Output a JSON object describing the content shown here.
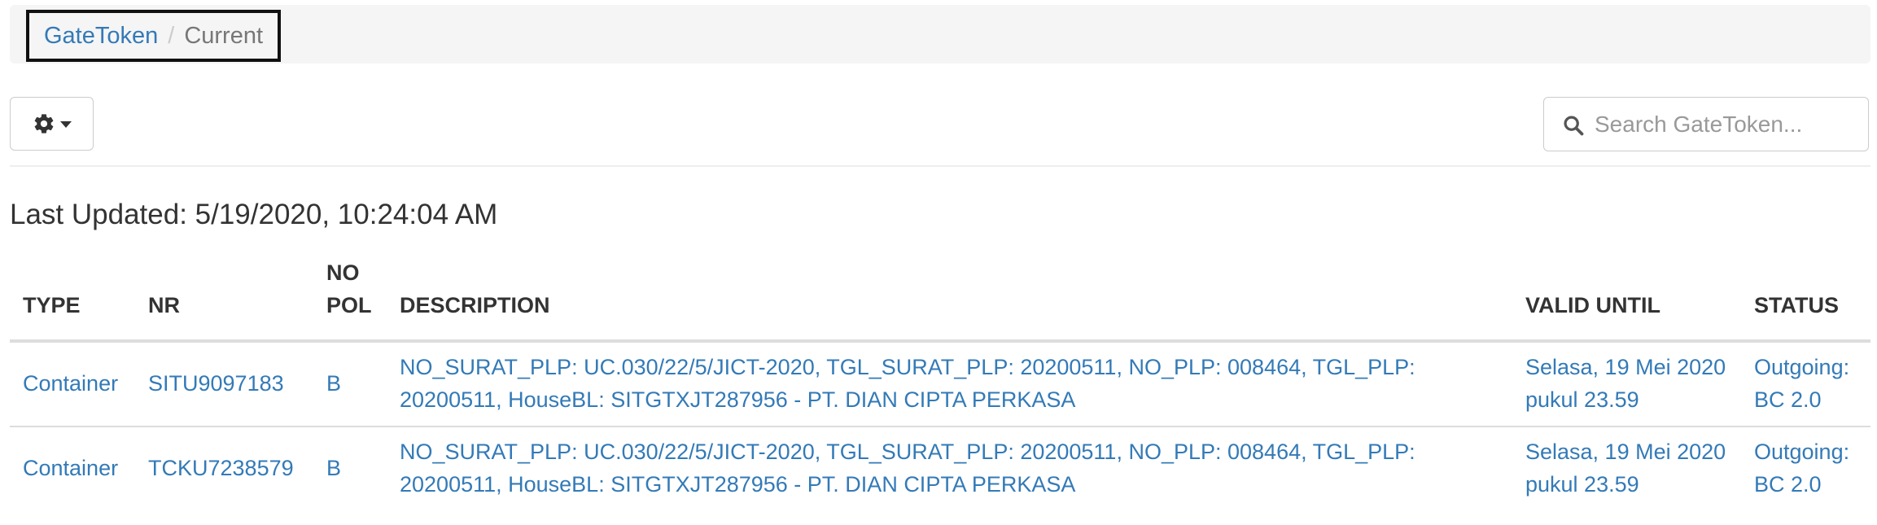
{
  "breadcrumb": {
    "root": "GateToken",
    "separator": "/",
    "current": "Current"
  },
  "toolbar": {
    "settings_icon": "gear-icon",
    "search_placeholder": "Search GateToken...",
    "search_value": ""
  },
  "last_updated": "Last Updated: 5/19/2020, 10:24:04 AM",
  "table": {
    "headers": {
      "type": "TYPE",
      "nr": "NR",
      "no_pol_line1": "NO",
      "no_pol_line2": "POL",
      "description": "DESCRIPTION",
      "valid_until": "VALID UNTIL",
      "status": "STATUS"
    },
    "rows": [
      {
        "type": "Container",
        "nr": "SITU9097183",
        "no_pol": "B",
        "description": "NO_SURAT_PLP: UC.030/22/5/JICT-2020, TGL_SURAT_PLP: 20200511, NO_PLP: 008464, TGL_PLP: 20200511, HouseBL: SITGTXJT287956 - PT. DIAN CIPTA PERKASA",
        "valid_until": "Selasa, 19 Mei 2020 pukul 23.59",
        "status": "Outgoing: BC 2.0"
      },
      {
        "type": "Container",
        "nr": "TCKU7238579",
        "no_pol": "B",
        "description": "NO_SURAT_PLP: UC.030/22/5/JICT-2020, TGL_SURAT_PLP: 20200511, NO_PLP: 008464, TGL_PLP: 20200511, HouseBL: SITGTXJT287956 - PT. DIAN CIPTA PERKASA",
        "valid_until": "Selasa, 19 Mei 2020 pukul 23.59",
        "status": "Outgoing: BC 2.0"
      }
    ]
  },
  "colors": {
    "link": "#337ab7",
    "text": "#333333",
    "muted": "#777777",
    "breadcrumb_bg": "#f5f5f5",
    "border": "#dddddd"
  }
}
